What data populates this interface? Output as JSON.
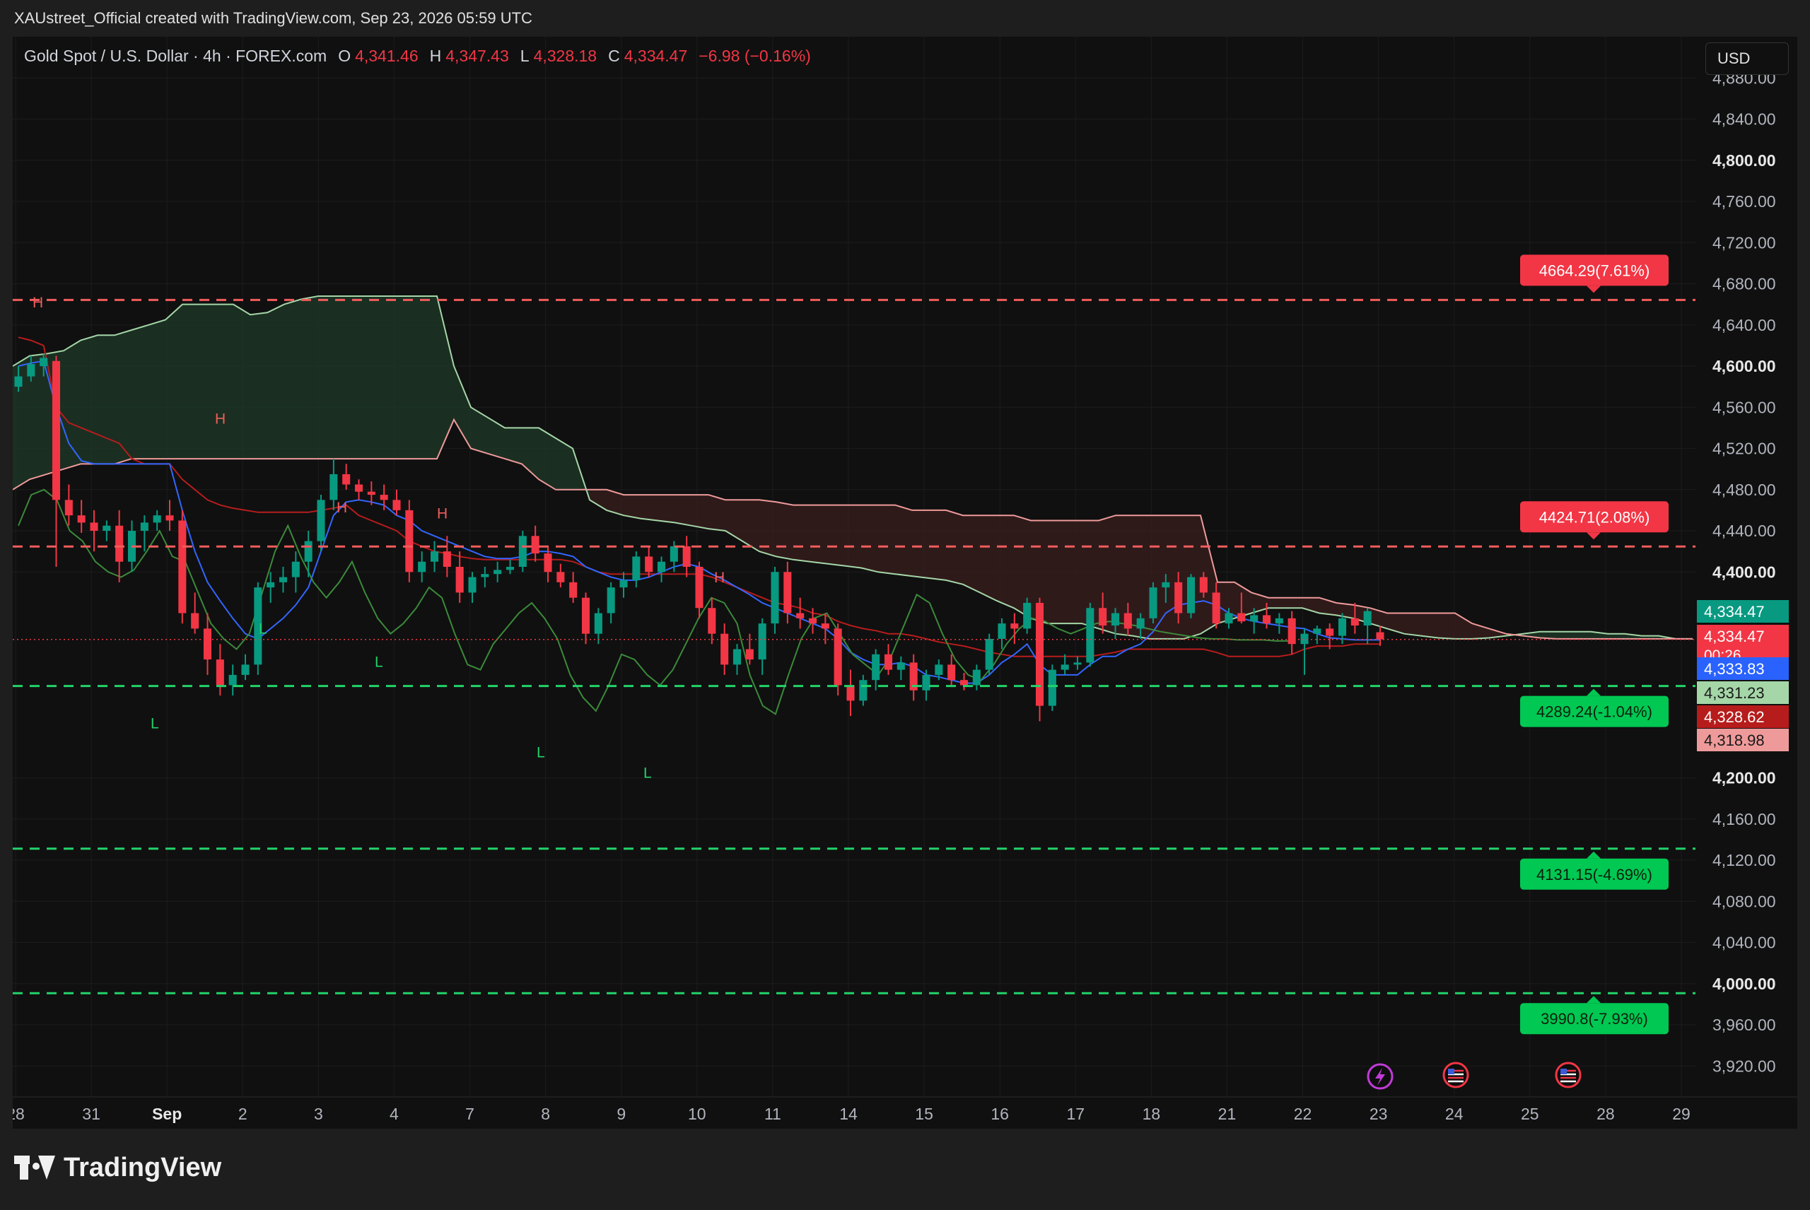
{
  "header": {
    "attribution": "XAUstreet_Official created with TradingView.com, Sep 23, 2026 05:59 UTC"
  },
  "legend": {
    "symbol": "Gold Spot / U.S. Dollar · 4h · FOREX.com",
    "o_label": "O",
    "o_value": "4,341.46",
    "h_label": "H",
    "h_value": "4,347.43",
    "l_label": "L",
    "l_value": "4,328.18",
    "c_label": "C",
    "c_value": "4,334.47",
    "change": "−6.98 (−0.16%)"
  },
  "currency_button": "USD",
  "footer": {
    "brand": "TradingView"
  },
  "colors": {
    "bull": "#089981",
    "bear": "#f23645",
    "bull_line": "#22d36a",
    "bear_line": "#f25c5c",
    "fast_line": "#3366ff",
    "lag_line": "#3b8a3b",
    "cloud_green": "#1e3a28",
    "cloud_red": "#3a1e1e"
  },
  "chart_data": {
    "type": "candlestick",
    "ylim": [
      3890,
      4920
    ],
    "y_ticks": [
      "4,880.00",
      "4,840.00",
      "4,800.00",
      "4,760.00",
      "4,720.00",
      "4,680.00",
      "4,640.00",
      "4,600.00",
      "4,560.00",
      "4,520.00",
      "4,480.00",
      "4,440.00",
      "4,400.00",
      "4,200.00",
      "4,160.00",
      "4,120.00",
      "4,080.00",
      "4,040.00",
      "4,000.00",
      "3,960.00",
      "3,920.00"
    ],
    "y_tick_values": [
      4880,
      4840,
      4800,
      4760,
      4720,
      4680,
      4640,
      4600,
      4560,
      4520,
      4480,
      4440,
      4400,
      4200,
      4160,
      4120,
      4080,
      4040,
      4000,
      3960,
      3920
    ],
    "bold_ticks": [
      "4,800.00",
      "4,600.00",
      "4,400.00",
      "4,200.00",
      "4,000.00"
    ],
    "x_ticks": [
      "28",
      "31",
      "Sep",
      "2",
      "3",
      "4",
      "7",
      "8",
      "9",
      "10",
      "11",
      "14",
      "15",
      "16",
      "17",
      "18",
      "21",
      "22",
      "23",
      "24",
      "25",
      "28",
      "29"
    ],
    "bold_x": [
      "Sep"
    ],
    "levels": [
      {
        "value": 4664.29,
        "label": "4664.29(7.61%)",
        "color": "#f25c5c"
      },
      {
        "value": 4424.71,
        "label": "4424.71(2.08%)",
        "color": "#f25c5c"
      },
      {
        "value": 4289.24,
        "label": "4289.24(-1.04%)",
        "color": "#22d36a"
      },
      {
        "value": 4131.15,
        "label": "4131.15(-4.69%)",
        "color": "#22d36a"
      },
      {
        "value": 3990.8,
        "label": "3990.8(-7.93%)",
        "color": "#22d36a"
      }
    ],
    "price_tags": [
      {
        "value": "4,334.47",
        "color": "#089981"
      },
      {
        "value": "4,334.47",
        "sub": "00:26",
        "color": "#f23645"
      },
      {
        "value": "4,333.83",
        "color": "#2962ff"
      },
      {
        "value": "4,331.23",
        "color": "#a5d6a7",
        "text": "#1a1a1a"
      },
      {
        "value": "4,328.62",
        "color": "#b71c1c"
      },
      {
        "value": "4,318.98",
        "color": "#ef9a9a",
        "text": "#1a1a1a"
      }
    ],
    "markers": [
      {
        "t": "H",
        "x": 28,
        "y": 4657,
        "color": "#f25c5c"
      },
      {
        "t": "H",
        "x": 286,
        "y": 4544,
        "color": "#f25c5c"
      },
      {
        "t": "H",
        "x": 458,
        "y": 4458,
        "color": "#f25c5c"
      },
      {
        "t": "H",
        "x": 600,
        "y": 4452,
        "color": "#f25c5c"
      },
      {
        "t": "H",
        "x": 992,
        "y": 4390,
        "color": "#f25c5c"
      },
      {
        "t": "L",
        "x": 195,
        "y": 4248,
        "color": "#22d36a"
      },
      {
        "t": "L",
        "x": 348,
        "y": 4340,
        "color": "#22d36a"
      },
      {
        "t": "L",
        "x": 512,
        "y": 4308,
        "color": "#22d36a"
      },
      {
        "t": "L",
        "x": 741,
        "y": 4220,
        "color": "#22d36a"
      },
      {
        "t": "L",
        "x": 892,
        "y": 4200,
        "color": "#22d36a"
      }
    ],
    "candles": [
      [
        4580,
        4600,
        4575,
        4590
      ],
      [
        4590,
        4610,
        4585,
        4602
      ],
      [
        4600,
        4612,
        4590,
        4608
      ],
      [
        4605,
        4610,
        4405,
        4470
      ],
      [
        4470,
        4485,
        4445,
        4455
      ],
      [
        4455,
        4470,
        4438,
        4448
      ],
      [
        4448,
        4460,
        4420,
        4440
      ],
      [
        4440,
        4450,
        4430,
        4445
      ],
      [
        4445,
        4460,
        4390,
        4410
      ],
      [
        4410,
        4450,
        4400,
        4440
      ],
      [
        4440,
        4455,
        4420,
        4448
      ],
      [
        4448,
        4460,
        4440,
        4455
      ],
      [
        4455,
        4470,
        4440,
        4450
      ],
      [
        4450,
        4460,
        4350,
        4360
      ],
      [
        4360,
        4380,
        4340,
        4345
      ],
      [
        4345,
        4360,
        4300,
        4315
      ],
      [
        4315,
        4330,
        4280,
        4290
      ],
      [
        4290,
        4310,
        4280,
        4300
      ],
      [
        4300,
        4320,
        4295,
        4310
      ],
      [
        4310,
        4390,
        4300,
        4385
      ],
      [
        4385,
        4400,
        4370,
        4390
      ],
      [
        4390,
        4405,
        4380,
        4395
      ],
      [
        4395,
        4420,
        4380,
        4410
      ],
      [
        4410,
        4440,
        4395,
        4430
      ],
      [
        4430,
        4475,
        4420,
        4470
      ],
      [
        4470,
        4510,
        4460,
        4495
      ],
      [
        4495,
        4505,
        4480,
        4485
      ],
      [
        4485,
        4490,
        4470,
        4478
      ],
      [
        4478,
        4488,
        4465,
        4475
      ],
      [
        4475,
        4485,
        4460,
        4470
      ],
      [
        4470,
        4480,
        4455,
        4460
      ],
      [
        4460,
        4470,
        4390,
        4400
      ],
      [
        4400,
        4420,
        4390,
        4410
      ],
      [
        4410,
        4430,
        4400,
        4420
      ],
      [
        4420,
        4435,
        4395,
        4405
      ],
      [
        4405,
        4420,
        4370,
        4380
      ],
      [
        4380,
        4400,
        4370,
        4395
      ],
      [
        4395,
        4405,
        4385,
        4398
      ],
      [
        4398,
        4410,
        4390,
        4402
      ],
      [
        4402,
        4412,
        4398,
        4405
      ],
      [
        4405,
        4440,
        4400,
        4435
      ],
      [
        4435,
        4445,
        4410,
        4418
      ],
      [
        4418,
        4425,
        4390,
        4400
      ],
      [
        4400,
        4408,
        4385,
        4390
      ],
      [
        4390,
        4400,
        4370,
        4375
      ],
      [
        4375,
        4380,
        4330,
        4340
      ],
      [
        4340,
        4365,
        4330,
        4360
      ],
      [
        4360,
        4390,
        4350,
        4385
      ],
      [
        4385,
        4400,
        4375,
        4392
      ],
      [
        4392,
        4420,
        4385,
        4415
      ],
      [
        4415,
        4425,
        4395,
        4400
      ],
      [
        4400,
        4415,
        4390,
        4410
      ],
      [
        4410,
        4430,
        4400,
        4425
      ],
      [
        4425,
        4435,
        4395,
        4405
      ],
      [
        4405,
        4410,
        4355,
        4365
      ],
      [
        4365,
        4375,
        4330,
        4340
      ],
      [
        4340,
        4350,
        4300,
        4310
      ],
      [
        4310,
        4330,
        4300,
        4325
      ],
      [
        4325,
        4340,
        4310,
        4315
      ],
      [
        4315,
        4355,
        4300,
        4350
      ],
      [
        4350,
        4405,
        4340,
        4400
      ],
      [
        4400,
        4410,
        4350,
        4360
      ],
      [
        4360,
        4375,
        4345,
        4355
      ],
      [
        4355,
        4365,
        4340,
        4350
      ],
      [
        4350,
        4360,
        4330,
        4345
      ],
      [
        4345,
        4350,
        4280,
        4290
      ],
      [
        4290,
        4305,
        4260,
        4275
      ],
      [
        4275,
        4300,
        4270,
        4295
      ],
      [
        4295,
        4325,
        4285,
        4320
      ],
      [
        4320,
        4330,
        4300,
        4305
      ],
      [
        4305,
        4318,
        4295,
        4312
      ],
      [
        4312,
        4320,
        4275,
        4285
      ],
      [
        4285,
        4305,
        4275,
        4300
      ],
      [
        4300,
        4315,
        4295,
        4310
      ],
      [
        4310,
        4320,
        4290,
        4295
      ],
      [
        4295,
        4302,
        4285,
        4290
      ],
      [
        4290,
        4310,
        4285,
        4305
      ],
      [
        4305,
        4340,
        4300,
        4335
      ],
      [
        4335,
        4355,
        4325,
        4350
      ],
      [
        4350,
        4360,
        4330,
        4345
      ],
      [
        4345,
        4375,
        4340,
        4370
      ],
      [
        4370,
        4375,
        4255,
        4270
      ],
      [
        4270,
        4310,
        4265,
        4305
      ],
      [
        4305,
        4320,
        4300,
        4310
      ],
      [
        4310,
        4318,
        4305,
        4312
      ],
      [
        4312,
        4370,
        4308,
        4365
      ],
      [
        4365,
        4380,
        4340,
        4348
      ],
      [
        4348,
        4365,
        4335,
        4360
      ],
      [
        4360,
        4370,
        4338,
        4345
      ],
      [
        4345,
        4360,
        4335,
        4355
      ],
      [
        4355,
        4390,
        4350,
        4385
      ],
      [
        4385,
        4398,
        4370,
        4390
      ],
      [
        4390,
        4400,
        4350,
        4360
      ],
      [
        4360,
        4398,
        4355,
        4395
      ],
      [
        4395,
        4400,
        4375,
        4380
      ],
      [
        4380,
        4390,
        4345,
        4350
      ],
      [
        4350,
        4365,
        4345,
        4360
      ],
      [
        4360,
        4380,
        4350,
        4352
      ],
      [
        4352,
        4365,
        4340,
        4358
      ],
      [
        4358,
        4370,
        4345,
        4350
      ],
      [
        4350,
        4360,
        4340,
        4355
      ],
      [
        4355,
        4362,
        4320,
        4330
      ],
      [
        4330,
        4345,
        4300,
        4340
      ],
      [
        4340,
        4348,
        4330,
        4345
      ],
      [
        4345,
        4350,
        4325,
        4338
      ],
      [
        4338,
        4360,
        4330,
        4355
      ],
      [
        4355,
        4370,
        4340,
        4348
      ],
      [
        4348,
        4365,
        4330,
        4362
      ],
      [
        4341.46,
        4347.43,
        4328.18,
        4334.47
      ]
    ],
    "fast_line": [
      4600,
      4603,
      4605,
      4560,
      4525,
      4508,
      4505,
      4505,
      4505,
      4505,
      4505,
      4505,
      4505,
      4460,
      4420,
      4390,
      4372,
      4355,
      4340,
      4335,
      4345,
      4355,
      4368,
      4385,
      4420,
      4455,
      4468,
      4470,
      4468,
      4465,
      4455,
      4450,
      4440,
      4435,
      4430,
      4425,
      4420,
      4415,
      4413,
      4413,
      4415,
      4420,
      4420,
      4418,
      4415,
      4405,
      4400,
      4395,
      4392,
      4392,
      4395,
      4400,
      4405,
      4408,
      4405,
      4398,
      4392,
      4385,
      4378,
      4370,
      4365,
      4360,
      4355,
      4350,
      4345,
      4335,
      4322,
      4315,
      4310,
      4310,
      4312,
      4308,
      4300,
      4298,
      4295,
      4292,
      4292,
      4300,
      4312,
      4320,
      4330,
      4310,
      4300,
      4300,
      4300,
      4310,
      4318,
      4318,
      4325,
      4330,
      4342,
      4360,
      4368,
      4370,
      4372,
      4368,
      4360,
      4355,
      4352,
      4350,
      4348,
      4346,
      4345,
      4340,
      4336,
      4335,
      4334,
      4334,
      4334
    ],
    "base_line": [
      4628,
      4625,
      4620,
      4560,
      4545,
      4540,
      4535,
      4530,
      4525,
      4510,
      4505,
      4505,
      4505,
      4490,
      4480,
      4470,
      4465,
      4462,
      4460,
      4458,
      4458,
      4458,
      4458,
      4458,
      4460,
      4462,
      4465,
      4455,
      4450,
      4445,
      4440,
      4430,
      4425,
      4420,
      4418,
      4415,
      4413,
      4412,
      4412,
      4412,
      4412,
      4412,
      4412,
      4412,
      4410,
      4405,
      4400,
      4398,
      4398,
      4398,
      4398,
      4398,
      4398,
      4398,
      4398,
      4395,
      4390,
      4385,
      4380,
      4375,
      4370,
      4368,
      4365,
      4360,
      4358,
      4352,
      4348,
      4345,
      4343,
      4340,
      4340,
      4338,
      4335,
      4332,
      4330,
      4328,
      4325,
      4322,
      4320,
      4318,
      4318,
      4318,
      4318,
      4318,
      4318,
      4318,
      4320,
      4322,
      4325,
      4325,
      4325,
      4325,
      4325,
      4325,
      4325,
      4322,
      4318,
      4318,
      4318,
      4318,
      4318,
      4320,
      4325,
      4328,
      4328,
      4328,
      4330,
      4330,
      4330
    ],
    "lag_line": [
      4445,
      4475,
      4480,
      4470,
      4440,
      4430,
      4410,
      4400,
      4395,
      4402,
      4420,
      4440,
      4415,
      4410,
      4380,
      4350,
      4335,
      4325,
      4340,
      4380,
      4420,
      4445,
      4415,
      4390,
      4375,
      4390,
      4410,
      4380,
      4355,
      4340,
      4350,
      4365,
      4385,
      4375,
      4340,
      4310,
      4305,
      4330,
      4345,
      4360,
      4370,
      4355,
      4335,
      4300,
      4278,
      4265,
      4290,
      4320,
      4315,
      4300,
      4290,
      4305,
      4330,
      4355,
      4375,
      4370,
      4350,
      4300,
      4270,
      4262,
      4300,
      4335,
      4355,
      4360,
      4340,
      4320,
      4310,
      4300,
      4318,
      4348,
      4378,
      4370,
      4340,
      4315,
      4300,
      4295,
      4310,
      4330,
      4345,
      4355,
      4352,
      4345,
      4340,
      4345,
      4350,
      4352,
      4350,
      4348,
      4345,
      4342,
      4340,
      4338,
      4336,
      4335,
      4335,
      4334,
      4334,
      4334,
      4333,
      4333
    ],
    "span_a": [
      4600,
      4610,
      4612,
      4615,
      4625,
      4630,
      4630,
      4635,
      4640,
      4645,
      4660,
      4660,
      4660,
      4660,
      4650,
      4652,
      4660,
      4665,
      4668,
      4668,
      4668,
      4668,
      4668,
      4668,
      4668,
      4668,
      4600,
      4560,
      4550,
      4540,
      4540,
      4540,
      4530,
      4520,
      4470,
      4460,
      4455,
      4452,
      4450,
      4448,
      4445,
      4442,
      4440,
      4430,
      4420,
      4415,
      4412,
      4410,
      4408,
      4406,
      4404,
      4400,
      4398,
      4396,
      4394,
      4392,
      4388,
      4380,
      4372,
      4365,
      4355,
      4350,
      4350,
      4350,
      4345,
      4340,
      4338,
      4335,
      4335,
      4335,
      4340,
      4350,
      4355,
      4360,
      4365,
      4365,
      4365,
      4360,
      4358,
      4355,
      4350,
      4345,
      4340,
      4338,
      4336,
      4335,
      4335,
      4336,
      4338,
      4340,
      4342,
      4342,
      4342,
      4342,
      4340,
      4340,
      4338,
      4338,
      4335,
      4335
    ],
    "span_b": [
      4480,
      4490,
      4495,
      4500,
      4505,
      4505,
      4505,
      4510,
      4510,
      4510,
      4510,
      4510,
      4510,
      4510,
      4510,
      4510,
      4510,
      4510,
      4510,
      4510,
      4510,
      4510,
      4510,
      4510,
      4510,
      4510,
      4548,
      4520,
      4515,
      4510,
      4505,
      4490,
      4480,
      4480,
      4480,
      4480,
      4475,
      4475,
      4475,
      4475,
      4475,
      4475,
      4470,
      4470,
      4470,
      4468,
      4465,
      4465,
      4465,
      4465,
      4465,
      4465,
      4465,
      4460,
      4460,
      4460,
      4455,
      4455,
      4455,
      4455,
      4450,
      4450,
      4450,
      4450,
      4450,
      4455,
      4455,
      4455,
      4455,
      4455,
      4455,
      4390,
      4390,
      4380,
      4375,
      4375,
      4375,
      4375,
      4370,
      4368,
      4365,
      4360,
      4360,
      4360,
      4360,
      4360,
      4350,
      4345,
      4340,
      4338,
      4336,
      4335,
      4335,
      4335,
      4335,
      4335,
      4335,
      4335,
      4335,
      4335
    ]
  }
}
